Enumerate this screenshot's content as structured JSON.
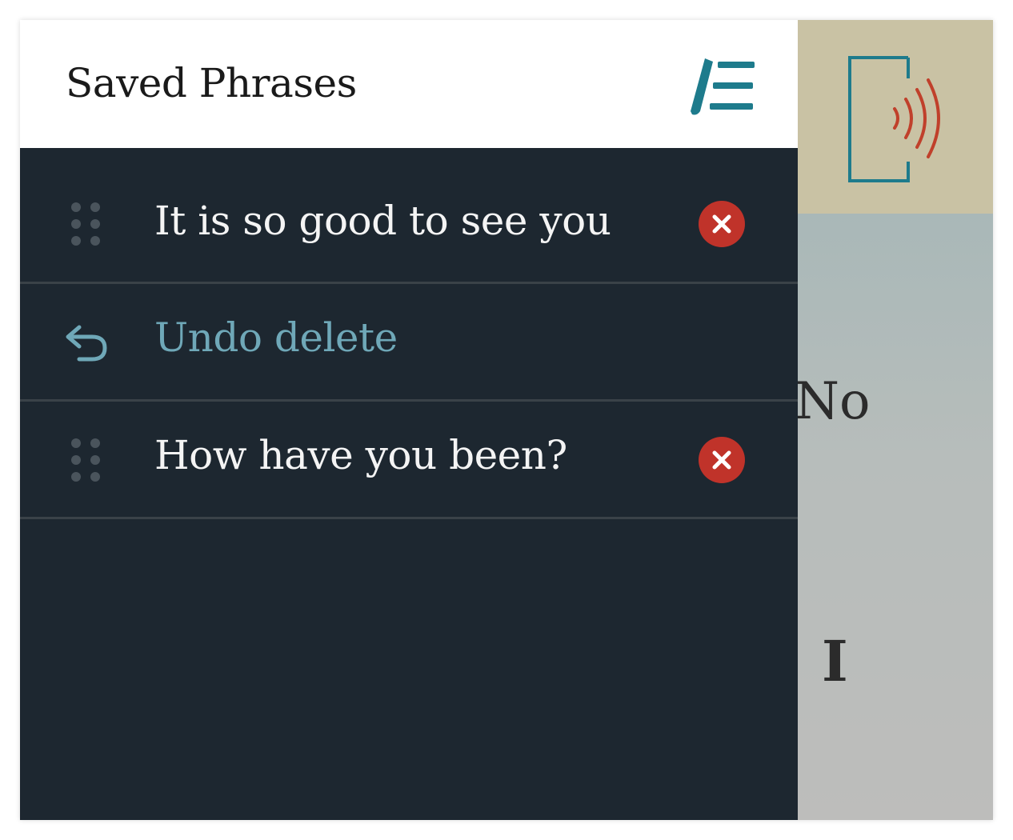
{
  "drawer": {
    "title": "Saved Phrases",
    "header_icon": "edit-list-icon",
    "rows": [
      {
        "type": "phrase",
        "text": "It is so good to see you",
        "icon_left": "drag-handle-icon",
        "icon_right": "delete-icon"
      },
      {
        "type": "undo",
        "text": "Undo delete",
        "icon_left": "undo-icon"
      },
      {
        "type": "phrase",
        "text": "How have you been?",
        "icon_left": "drag-handle-icon",
        "icon_right": "delete-icon"
      }
    ]
  },
  "background": {
    "speaker_icon": "speaker-icon",
    "words": [
      "No",
      "I"
    ]
  },
  "colors": {
    "drawer_bg": "#1d2730",
    "header_bg": "#ffffff",
    "accent_teal": "#1e7b8c",
    "undo_text": "#6fa8b8",
    "delete_red": "#c0332a",
    "speaker_red": "#c0402b",
    "background_header": "#c9c2a4"
  }
}
